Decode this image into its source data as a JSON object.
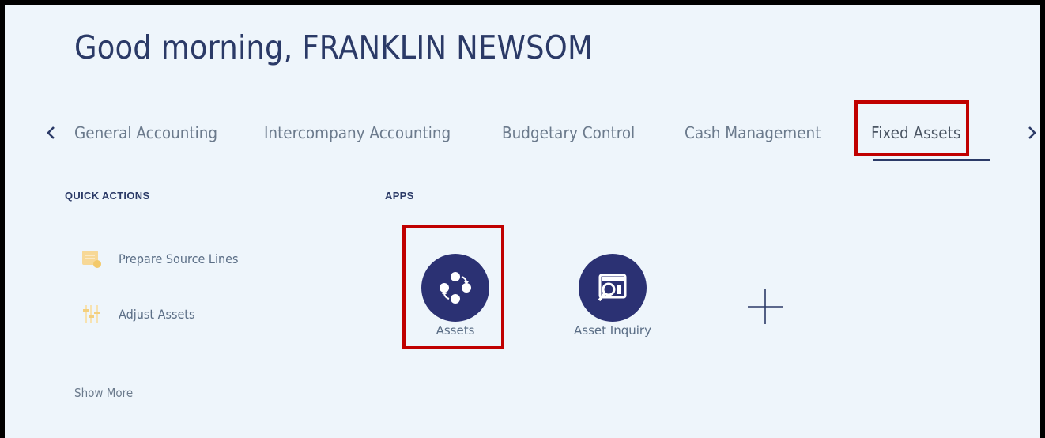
{
  "header": {
    "greeting": "Good morning, FRANKLIN NEWSOM"
  },
  "tabs": [
    {
      "label": "General Accounting",
      "active": false
    },
    {
      "label": "Intercompany Accounting",
      "active": false
    },
    {
      "label": "Budgetary Control",
      "active": false
    },
    {
      "label": "Cash Management",
      "active": false
    },
    {
      "label": "Fixed Assets",
      "active": true
    }
  ],
  "quick_actions": {
    "title": "QUICK ACTIONS",
    "items": [
      {
        "label": "Prepare Source Lines",
        "icon": "prepare-source-lines-icon"
      },
      {
        "label": "Adjust Assets",
        "icon": "adjust-assets-icon"
      }
    ],
    "show_more": "Show More"
  },
  "apps": {
    "title": "APPS",
    "items": [
      {
        "label": "Assets",
        "icon": "assets-cycle-icon"
      },
      {
        "label": "Asset Inquiry",
        "icon": "asset-inquiry-icon"
      }
    ]
  },
  "colors": {
    "background": "#eef5fb",
    "brand_dark": "#2b3173",
    "title_text": "#2b3a67",
    "highlight": "#c00000",
    "quick_action_icon": "#f7d896"
  }
}
